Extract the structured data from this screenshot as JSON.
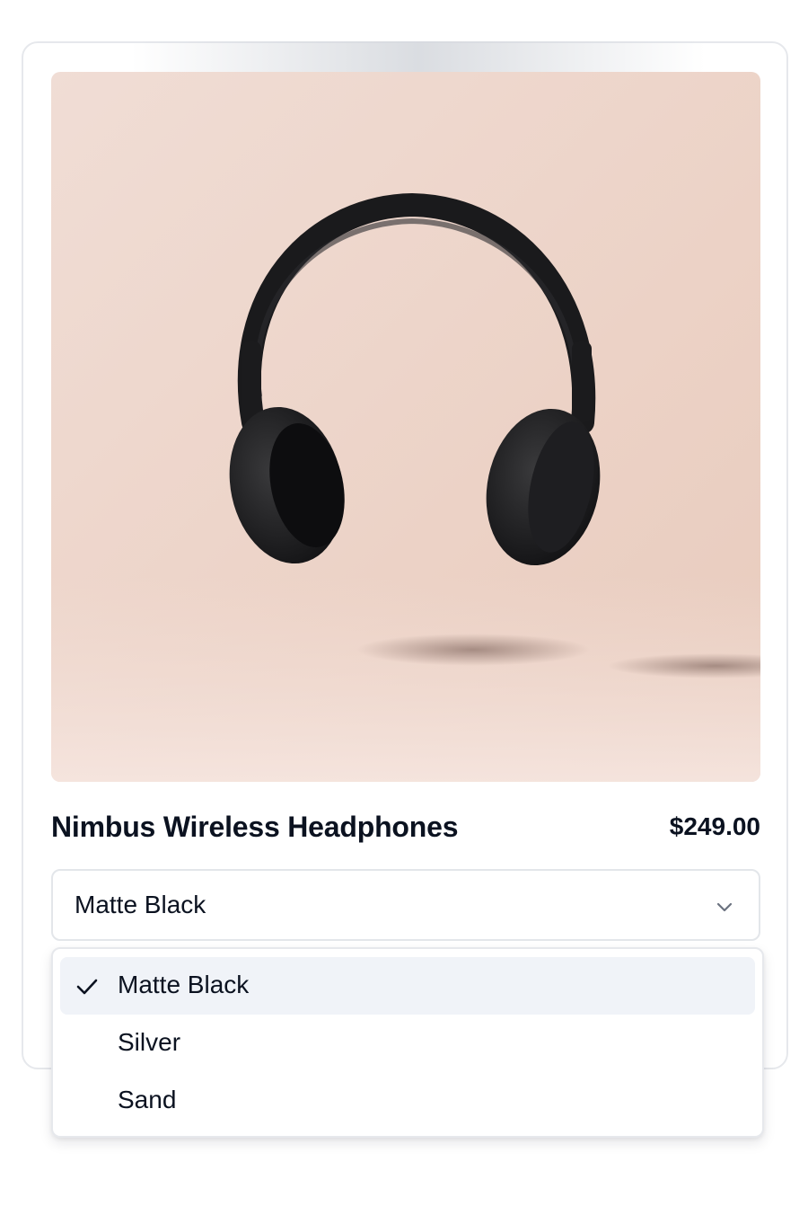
{
  "product": {
    "title": "Nimbus Wireless Headphones",
    "price": "$249.00",
    "image_icon": "headphones-photo"
  },
  "color_select": {
    "value": "Matte Black",
    "options": [
      {
        "label": "Matte Black",
        "selected": true
      },
      {
        "label": "Silver",
        "selected": false
      },
      {
        "label": "Sand",
        "selected": false
      }
    ]
  },
  "colors": {
    "image_background": "#eed8cf",
    "selected_option_bg": "#f0f3f8",
    "text": "#0b1220",
    "border": "#e3e6ea"
  }
}
